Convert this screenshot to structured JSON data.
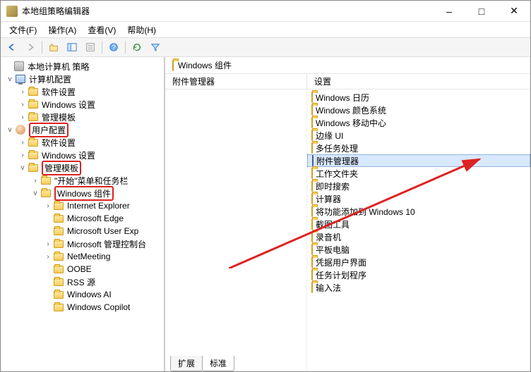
{
  "window": {
    "title": "本地组策略编辑器"
  },
  "menubar": {
    "file": "文件(F)",
    "action": "操作(A)",
    "view": "查看(V)",
    "help": "帮助(H)"
  },
  "tree": {
    "root": "本地计算机 策略",
    "computer_config": "计算机配置",
    "cc_software": "软件设置",
    "cc_windows": "Windows 设置",
    "cc_admin": "管理模板",
    "user_config": "用户配置",
    "uc_software": "软件设置",
    "uc_windows": "Windows 设置",
    "uc_admin": "管理模板",
    "start_menu": "\"开始\"菜单和任务栏",
    "win_components": "Windows 组件",
    "ie": "Internet Explorer",
    "edge": "Microsoft Edge",
    "user_exp": "Microsoft User Exp",
    "mmc": "Microsoft 管理控制台",
    "netmeeting": "NetMeeting",
    "oobe": "OOBE",
    "rss": "RSS 源",
    "winai": "Windows AI",
    "copilot": "Windows Copilot"
  },
  "rightpane": {
    "header_title": "Windows 组件",
    "col_left": "附件管理器",
    "col_right": "设置",
    "items": [
      "Windows 日历",
      "Windows 颜色系统",
      "Windows 移动中心",
      "边缘 UI",
      "多任务处理",
      "附件管理器",
      "工作文件夹",
      "即时搜索",
      "计算器",
      "将功能添加到 Windows 10",
      "截图工具",
      "录音机",
      "平板电脑",
      "凭据用户界面",
      "任务计划程序",
      "输入法"
    ],
    "selected_index": 5
  },
  "tabs": {
    "extended": "扩展",
    "standard": "标准"
  }
}
